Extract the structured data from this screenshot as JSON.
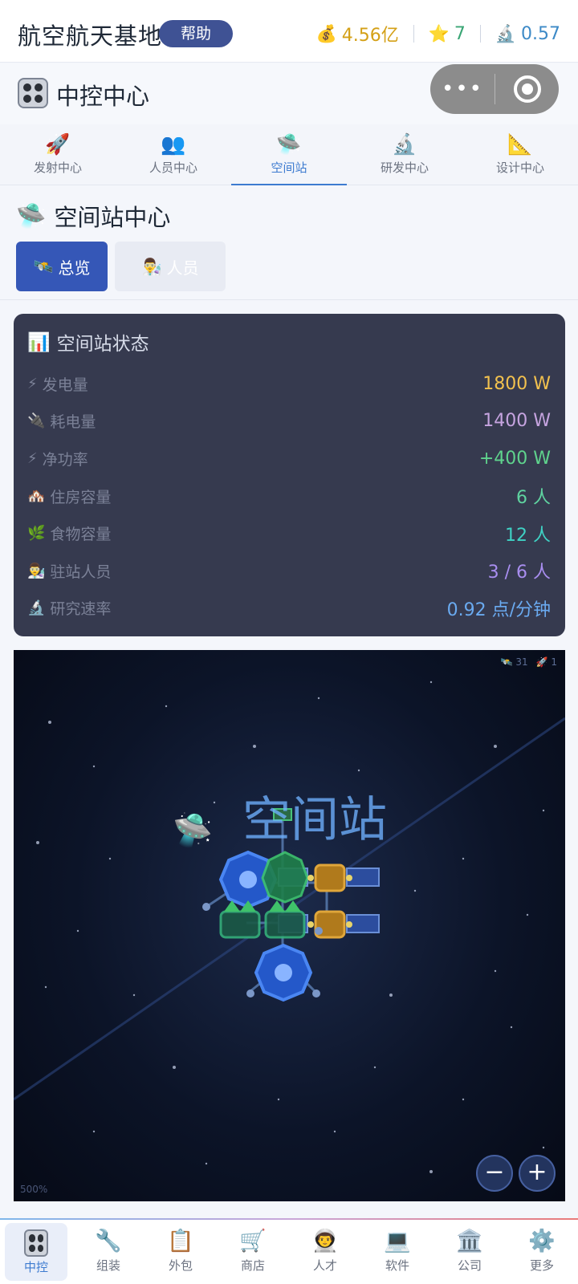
{
  "header": {
    "title": "航空航天基地",
    "help_label": "帮助",
    "money": "4.56亿",
    "stars": "7",
    "research": "0.57",
    "money_icon": "money-bag-icon",
    "star_icon": "star-icon",
    "research_icon": "microscope-icon"
  },
  "page": {
    "title": "中控中心",
    "icon": "control-panel-icon",
    "capsule_more": "•••"
  },
  "tabs": [
    {
      "label": "发射中心",
      "icon": "rocket-icon",
      "glyph": "🚀",
      "active": false
    },
    {
      "label": "人员中心",
      "icon": "people-icon",
      "glyph": "👥",
      "active": false
    },
    {
      "label": "空间站",
      "icon": "ufo-icon",
      "glyph": "🛸",
      "active": true
    },
    {
      "label": "研发中心",
      "icon": "microscope-icon",
      "glyph": "🔬",
      "active": false
    },
    {
      "label": "设计中心",
      "icon": "triangle-ruler-icon",
      "glyph": "📐",
      "active": false
    }
  ],
  "section": {
    "title": "空间站中心",
    "icon": "ufo-icon",
    "subtabs": [
      {
        "label": "总览",
        "icon": "satellite-icon",
        "glyph": "🛰️"
      },
      {
        "label": "人员",
        "icon": "scientist-icon",
        "glyph": "👨‍🔬"
      }
    ]
  },
  "status": {
    "title": "空间站状态",
    "title_icon": "bar-chart-icon",
    "rows": [
      {
        "label": "发电量",
        "icon": "lightning-icon",
        "glyph": "⚡",
        "value": "1800 W",
        "color": "#f2c14e"
      },
      {
        "label": "耗电量",
        "icon": "plug-icon",
        "glyph": "🔌",
        "value": "1400 W",
        "color": "#c6a4e0"
      },
      {
        "label": "净功率",
        "icon": "lightning-icon",
        "glyph": "⚡",
        "value": "+400 W",
        "color": "#5fd38d"
      },
      {
        "label": "住房容量",
        "icon": "house-icon",
        "glyph": "🏘️",
        "value": "6 人",
        "color": "#5fd3a0"
      },
      {
        "label": "食物容量",
        "icon": "herb-icon",
        "glyph": "🌿",
        "value": "12 人",
        "color": "#3fd1c4"
      },
      {
        "label": "驻站人员",
        "icon": "scientist-icon",
        "glyph": "👨‍🔬",
        "value": "3 / 6 人",
        "color": "#a98ef0"
      },
      {
        "label": "研究速率",
        "icon": "microscope-icon",
        "glyph": "🔬",
        "value": "0.92 点/分钟",
        "color": "#6aaaf0"
      }
    ]
  },
  "viewport": {
    "label": "空间站",
    "satellites": "31",
    "rockets": "1",
    "zoom": "500%",
    "zoom_out": "−",
    "zoom_in": "+"
  },
  "bottomnav": [
    {
      "label": "中控",
      "icon": "control-panel-icon",
      "glyph": "",
      "active": true
    },
    {
      "label": "组装",
      "icon": "wrench-icon",
      "glyph": "🔧",
      "active": false
    },
    {
      "label": "外包",
      "icon": "clipboard-icon",
      "glyph": "📋",
      "active": false
    },
    {
      "label": "商店",
      "icon": "cart-icon",
      "glyph": "🛒",
      "active": false
    },
    {
      "label": "人才",
      "icon": "person-rocket-icon",
      "glyph": "👨‍🚀",
      "active": false
    },
    {
      "label": "软件",
      "icon": "laptop-icon",
      "glyph": "💻",
      "active": false
    },
    {
      "label": "公司",
      "icon": "office-building-icon",
      "glyph": "🏛️",
      "active": false
    },
    {
      "label": "更多",
      "icon": "gear-icon",
      "glyph": "⚙️",
      "active": false
    }
  ]
}
